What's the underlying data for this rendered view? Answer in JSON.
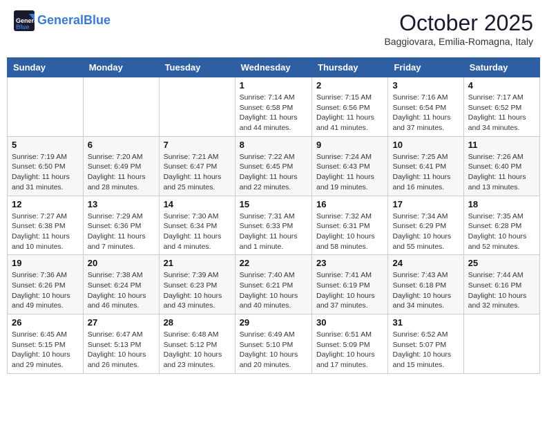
{
  "header": {
    "logo_line1": "General",
    "logo_line2": "Blue",
    "month_title": "October 2025",
    "location": "Baggiovara, Emilia-Romagna, Italy"
  },
  "weekdays": [
    "Sunday",
    "Monday",
    "Tuesday",
    "Wednesday",
    "Thursday",
    "Friday",
    "Saturday"
  ],
  "weeks": [
    [
      {
        "day": "",
        "info": ""
      },
      {
        "day": "",
        "info": ""
      },
      {
        "day": "",
        "info": ""
      },
      {
        "day": "1",
        "info": "Sunrise: 7:14 AM\nSunset: 6:58 PM\nDaylight: 11 hours and 44 minutes."
      },
      {
        "day": "2",
        "info": "Sunrise: 7:15 AM\nSunset: 6:56 PM\nDaylight: 11 hours and 41 minutes."
      },
      {
        "day": "3",
        "info": "Sunrise: 7:16 AM\nSunset: 6:54 PM\nDaylight: 11 hours and 37 minutes."
      },
      {
        "day": "4",
        "info": "Sunrise: 7:17 AM\nSunset: 6:52 PM\nDaylight: 11 hours and 34 minutes."
      }
    ],
    [
      {
        "day": "5",
        "info": "Sunrise: 7:19 AM\nSunset: 6:50 PM\nDaylight: 11 hours and 31 minutes."
      },
      {
        "day": "6",
        "info": "Sunrise: 7:20 AM\nSunset: 6:49 PM\nDaylight: 11 hours and 28 minutes."
      },
      {
        "day": "7",
        "info": "Sunrise: 7:21 AM\nSunset: 6:47 PM\nDaylight: 11 hours and 25 minutes."
      },
      {
        "day": "8",
        "info": "Sunrise: 7:22 AM\nSunset: 6:45 PM\nDaylight: 11 hours and 22 minutes."
      },
      {
        "day": "9",
        "info": "Sunrise: 7:24 AM\nSunset: 6:43 PM\nDaylight: 11 hours and 19 minutes."
      },
      {
        "day": "10",
        "info": "Sunrise: 7:25 AM\nSunset: 6:41 PM\nDaylight: 11 hours and 16 minutes."
      },
      {
        "day": "11",
        "info": "Sunrise: 7:26 AM\nSunset: 6:40 PM\nDaylight: 11 hours and 13 minutes."
      }
    ],
    [
      {
        "day": "12",
        "info": "Sunrise: 7:27 AM\nSunset: 6:38 PM\nDaylight: 11 hours and 10 minutes."
      },
      {
        "day": "13",
        "info": "Sunrise: 7:29 AM\nSunset: 6:36 PM\nDaylight: 11 hours and 7 minutes."
      },
      {
        "day": "14",
        "info": "Sunrise: 7:30 AM\nSunset: 6:34 PM\nDaylight: 11 hours and 4 minutes."
      },
      {
        "day": "15",
        "info": "Sunrise: 7:31 AM\nSunset: 6:33 PM\nDaylight: 11 hours and 1 minute."
      },
      {
        "day": "16",
        "info": "Sunrise: 7:32 AM\nSunset: 6:31 PM\nDaylight: 10 hours and 58 minutes."
      },
      {
        "day": "17",
        "info": "Sunrise: 7:34 AM\nSunset: 6:29 PM\nDaylight: 10 hours and 55 minutes."
      },
      {
        "day": "18",
        "info": "Sunrise: 7:35 AM\nSunset: 6:28 PM\nDaylight: 10 hours and 52 minutes."
      }
    ],
    [
      {
        "day": "19",
        "info": "Sunrise: 7:36 AM\nSunset: 6:26 PM\nDaylight: 10 hours and 49 minutes."
      },
      {
        "day": "20",
        "info": "Sunrise: 7:38 AM\nSunset: 6:24 PM\nDaylight: 10 hours and 46 minutes."
      },
      {
        "day": "21",
        "info": "Sunrise: 7:39 AM\nSunset: 6:23 PM\nDaylight: 10 hours and 43 minutes."
      },
      {
        "day": "22",
        "info": "Sunrise: 7:40 AM\nSunset: 6:21 PM\nDaylight: 10 hours and 40 minutes."
      },
      {
        "day": "23",
        "info": "Sunrise: 7:41 AM\nSunset: 6:19 PM\nDaylight: 10 hours and 37 minutes."
      },
      {
        "day": "24",
        "info": "Sunrise: 7:43 AM\nSunset: 6:18 PM\nDaylight: 10 hours and 34 minutes."
      },
      {
        "day": "25",
        "info": "Sunrise: 7:44 AM\nSunset: 6:16 PM\nDaylight: 10 hours and 32 minutes."
      }
    ],
    [
      {
        "day": "26",
        "info": "Sunrise: 6:45 AM\nSunset: 5:15 PM\nDaylight: 10 hours and 29 minutes."
      },
      {
        "day": "27",
        "info": "Sunrise: 6:47 AM\nSunset: 5:13 PM\nDaylight: 10 hours and 26 minutes."
      },
      {
        "day": "28",
        "info": "Sunrise: 6:48 AM\nSunset: 5:12 PM\nDaylight: 10 hours and 23 minutes."
      },
      {
        "day": "29",
        "info": "Sunrise: 6:49 AM\nSunset: 5:10 PM\nDaylight: 10 hours and 20 minutes."
      },
      {
        "day": "30",
        "info": "Sunrise: 6:51 AM\nSunset: 5:09 PM\nDaylight: 10 hours and 17 minutes."
      },
      {
        "day": "31",
        "info": "Sunrise: 6:52 AM\nSunset: 5:07 PM\nDaylight: 10 hours and 15 minutes."
      },
      {
        "day": "",
        "info": ""
      }
    ]
  ]
}
